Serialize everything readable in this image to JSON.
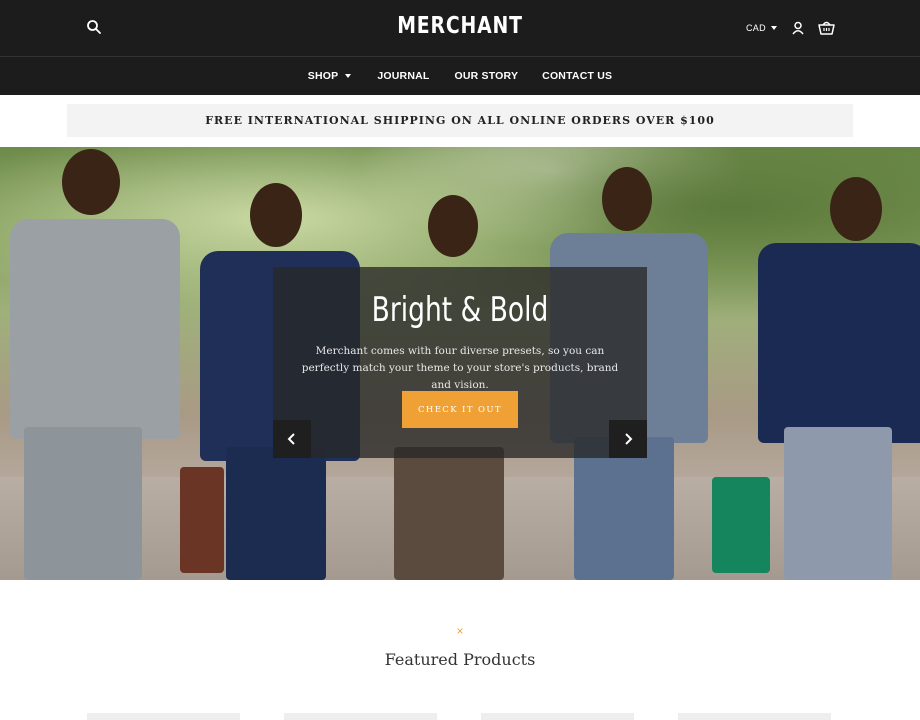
{
  "header": {
    "logo": "MERCHANT",
    "currency": "CAD",
    "icons": {
      "search": "search-icon",
      "account": "user-icon",
      "cart": "basket-icon"
    }
  },
  "nav": {
    "items": [
      {
        "label": "SHOP",
        "has_dropdown": true
      },
      {
        "label": "JOURNAL"
      },
      {
        "label": "OUR STORY"
      },
      {
        "label": "CONTACT US"
      }
    ]
  },
  "announcement": "FREE INTERNATIONAL SHIPPING ON ALL ONLINE ORDERS OVER $100",
  "hero": {
    "title": "Bright & Bold",
    "text": "Merchant comes with four diverse presets, so you can perfectly match your theme to your store's products, brand and vision.",
    "cta": "CHECK IT OUT",
    "prev_icon": "chevron-left-icon",
    "next_icon": "chevron-right-icon"
  },
  "featured": {
    "ornament": "×",
    "title": "Featured Products",
    "cards": 4
  },
  "colors": {
    "header_bg": "#1c1c1c",
    "accent": "#f0a136",
    "announce_bg": "#f3f3f3"
  }
}
